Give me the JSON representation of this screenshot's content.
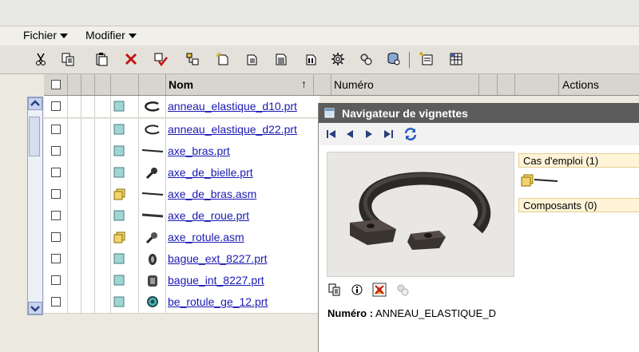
{
  "menubar": {
    "file": "Fichier",
    "edit": "Modifier"
  },
  "table": {
    "headers": {
      "name": "Nom",
      "sort_indicator": "↑",
      "number": "Numéro",
      "actions": "Actions"
    },
    "rows": [
      {
        "name": "anneau_elastique_d10.prt",
        "type": "part",
        "icon": "ring-icon"
      },
      {
        "name": "anneau_elastique_d22.prt",
        "type": "part",
        "icon": "ring-icon"
      },
      {
        "name": "axe_bras.prt",
        "type": "part",
        "icon": "rod-icon"
      },
      {
        "name": "axe_de_bielle.prt",
        "type": "part",
        "icon": "pin-icon"
      },
      {
        "name": "axe_de_bras.asm",
        "type": "assembly",
        "icon": "rod-icon"
      },
      {
        "name": "axe_de_roue.prt",
        "type": "part",
        "icon": "rod-icon"
      },
      {
        "name": "axe_rotule.asm",
        "type": "assembly",
        "icon": "pin-icon"
      },
      {
        "name": "bague_ext_8227.prt",
        "type": "part",
        "icon": "bushing-icon"
      },
      {
        "name": "bague_int_8227.prt",
        "type": "part",
        "icon": "bushing-icon"
      },
      {
        "name": "be_rotule_ge_12.prt",
        "type": "part",
        "icon": "ball-joint-icon"
      }
    ]
  },
  "navigator": {
    "title": "Navigateur de vignettes",
    "used_in": "Cas d'emploi (1)",
    "components": "Composants (0)",
    "number_label": "Numéro :",
    "number_value": "ANNEAU_ELASTIQUE_D"
  },
  "colors": {
    "link": "#1a1ab3",
    "nav_title_bg": "#5c5c5c",
    "accordion_bg": "#fff4d8",
    "part_icon": "#9fd6d3",
    "assembly_icon": "#f3d36d"
  }
}
